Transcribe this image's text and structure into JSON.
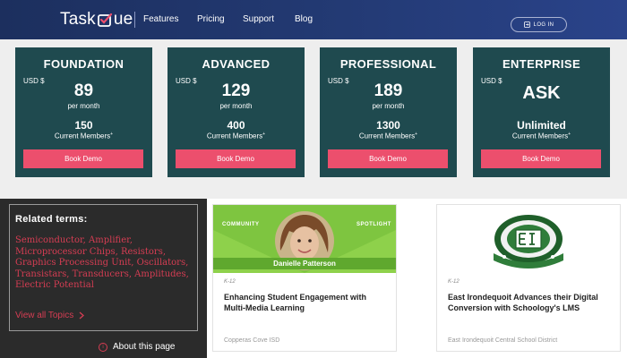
{
  "header": {
    "logo_prefix": "Task",
    "logo_suffix": "ue",
    "nav": [
      "Features",
      "Pricing",
      "Support",
      "Blog"
    ],
    "login_label": "LOG IN"
  },
  "plans": [
    {
      "name": "FOUNDATION",
      "currency": "USD $",
      "price": "89",
      "period": "per month",
      "members": "150",
      "members_label": "Current Members",
      "cta": "Book Demo"
    },
    {
      "name": "ADVANCED",
      "currency": "USD $",
      "price": "129",
      "period": "per month",
      "members": "400",
      "members_label": "Current Members",
      "cta": "Book Demo"
    },
    {
      "name": "PROFESSIONAL",
      "currency": "USD $",
      "price": "189",
      "period": "per month",
      "members": "1300",
      "members_label": "Current Members",
      "cta": "Book Demo"
    },
    {
      "name": "ENTERPRISE",
      "currency": "USD $",
      "price": "ASK",
      "period": "",
      "members": "Unlimited",
      "members_label": "Current Members",
      "cta": "Book Demo"
    }
  ],
  "related": {
    "title": "Related terms:",
    "terms": "Semiconductor, Amplifier, Microprocessor Chips, Resistors, Graphics Processing Unit, Oscillators, Transistars, Transducers, Amplitudes, Electric Potential",
    "view_all": "View all Topics",
    "about": "About this page"
  },
  "articles": [
    {
      "spotlight_left": "COMMUNITY",
      "spotlight_right": "SPOTLIGHT",
      "person": "Danielle Patterson",
      "tag": "K-12",
      "title": "Enhancing Student Engagement with Multi-Media Learning",
      "org": "Copperas Cove ISD"
    },
    {
      "tag": "K-12",
      "title": "East Irondequoit Advances their Digital Conversion with Schoology's LMS",
      "org": "East Irondequoit Central School District"
    }
  ],
  "colors": {
    "header": "#1c2f5e",
    "card": "#1f4a4f",
    "cta": "#ec4f6d",
    "terms": "#d63d53",
    "spotlight": "#7ec540"
  }
}
